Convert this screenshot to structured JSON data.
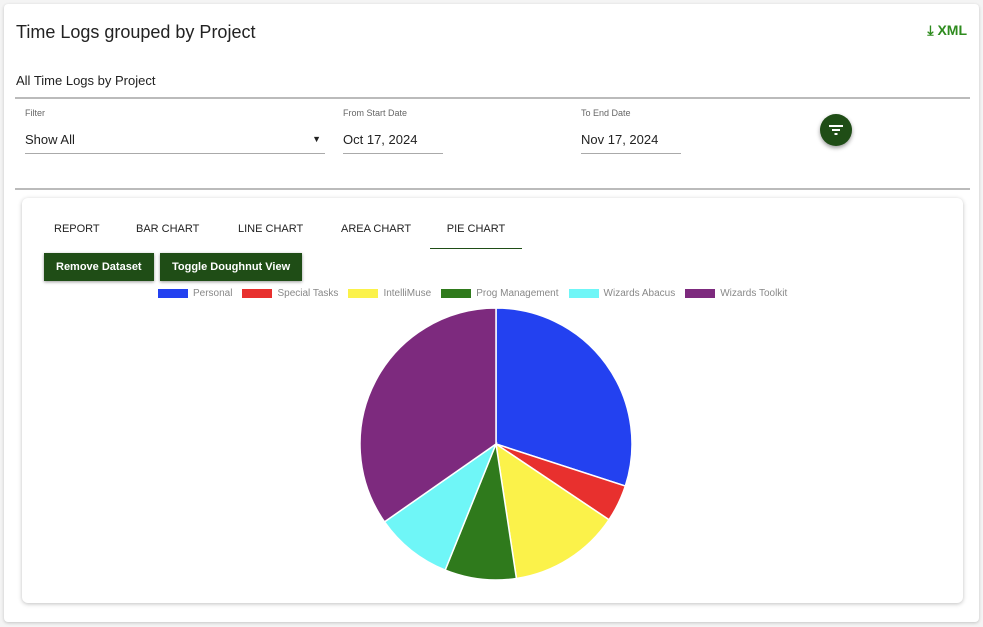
{
  "header": {
    "title": "Time Logs grouped by Project",
    "export_label": "XML",
    "subtitle": "All Time Logs by Project"
  },
  "filters": {
    "filter_label": "Filter",
    "filter_value": "Show All",
    "start_label": "From Start Date",
    "start_value": "Oct 17, 2024",
    "end_label": "To End Date",
    "end_value": "Nov 17, 2024"
  },
  "tabs": [
    {
      "label": "Report"
    },
    {
      "label": "Bar Chart"
    },
    {
      "label": "Line Chart"
    },
    {
      "label": "Area Chart"
    },
    {
      "label": "Pie Chart",
      "active": true
    }
  ],
  "buttons": {
    "remove": "Remove Dataset",
    "toggle": "Toggle Doughnut View"
  },
  "chart_data": {
    "type": "pie",
    "unit": "percent (estimated)",
    "categories": [
      "Personal",
      "Special Tasks",
      "IntelliMuse",
      "Prog Management",
      "Wizards Abacus",
      "Wizards Toolkit"
    ],
    "values": [
      30,
      4.4,
      13.2,
      8.5,
      9.2,
      34.7
    ],
    "colors": [
      "#2341f0",
      "#e8302e",
      "#fbf24a",
      "#2f7a1c",
      "#6ff6f7",
      "#7d2a7e"
    ],
    "legend": "top"
  }
}
